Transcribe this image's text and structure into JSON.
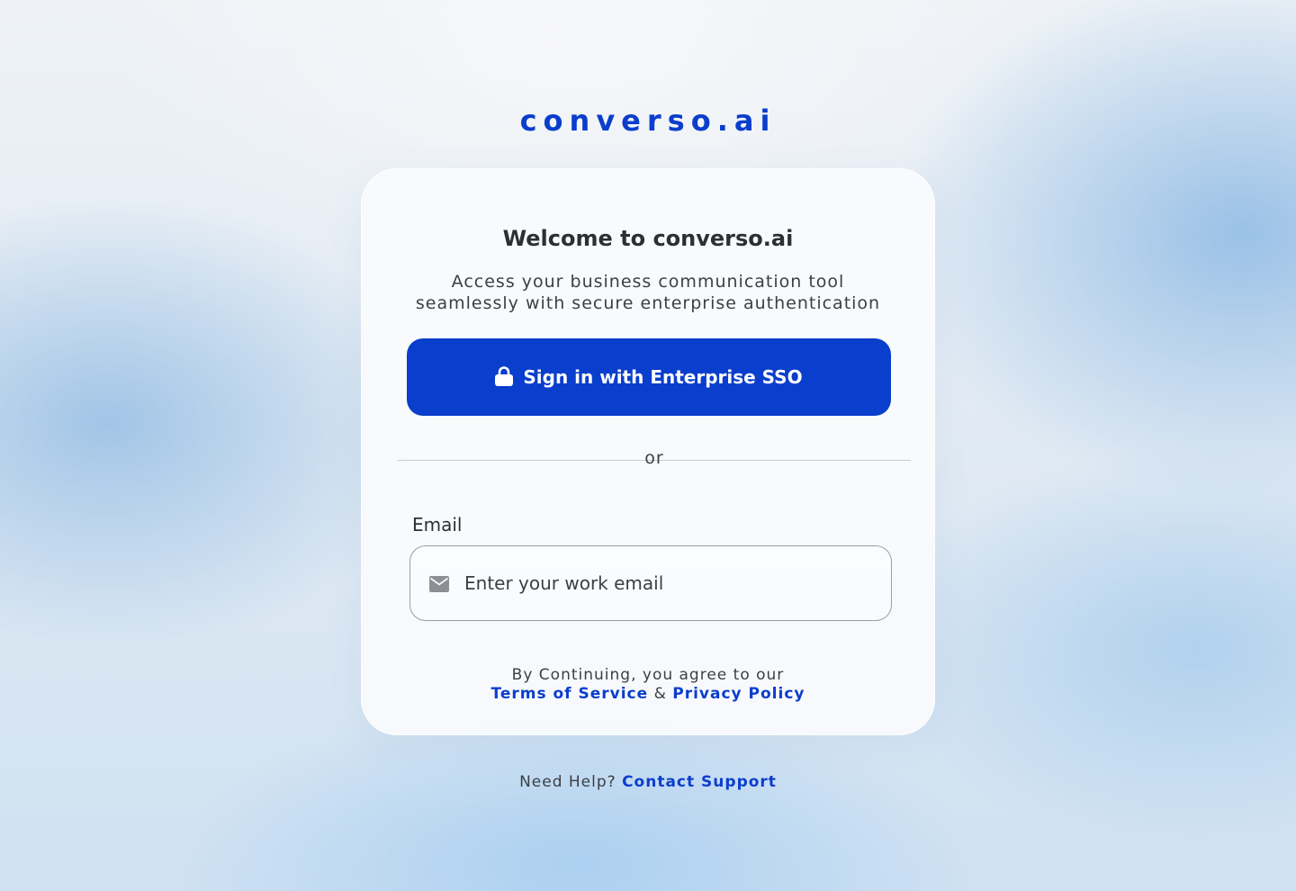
{
  "brand": {
    "name": "converso.ai",
    "color": "#0b3ecc"
  },
  "card": {
    "title": "Welcome to converso.ai",
    "subtitle_line1": "Access your business communication tool",
    "subtitle_line2": "seamlessly with secure enterprise authentication",
    "sso_button": {
      "label": "Sign in with Enterprise SSO",
      "icon": "lock-icon",
      "color": "#0a3ecc"
    },
    "divider_text": "or",
    "email": {
      "label": "Email",
      "placeholder": "Enter your work email",
      "value": "",
      "icon": "mail-icon"
    },
    "legal": {
      "prefix": "By Continuing, you agree to our",
      "terms_link": "Terms of Service",
      "connector": "&",
      "privacy_link": "Privacy Policy"
    }
  },
  "footer": {
    "help_text": "Need Help?",
    "support_link": "Contact Support"
  }
}
